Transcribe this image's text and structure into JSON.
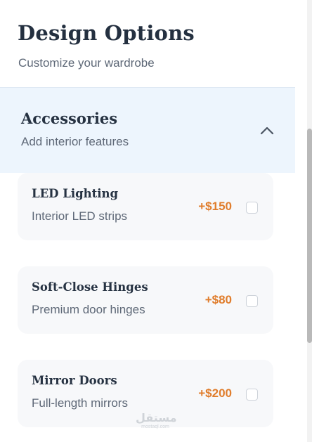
{
  "header": {
    "title": "Design Options",
    "subtitle": "Customize your wardrobe"
  },
  "section": {
    "title": "Accessories",
    "subtitle": "Add interior features",
    "toggle_icon": "chevron-up-icon",
    "expanded": true
  },
  "items": [
    {
      "name": "LED Lighting",
      "description": "Interior LED strips",
      "price": "+$150",
      "checked": false
    },
    {
      "name": "Soft-Close Hinges",
      "description": "Premium door hinges",
      "price": "+$80",
      "checked": false
    },
    {
      "name": "Mirror Doors",
      "description": "Full-length mirrors",
      "price": "+$200",
      "checked": false
    }
  ],
  "watermark": {
    "arabic": "مستقل",
    "latin": "mostaql.com"
  },
  "colors": {
    "title": "#243040",
    "muted_text": "#5e6877",
    "section_bg": "#edf5fd",
    "card_bg": "#f7f8fa",
    "price_accent": "#e07d2c"
  }
}
